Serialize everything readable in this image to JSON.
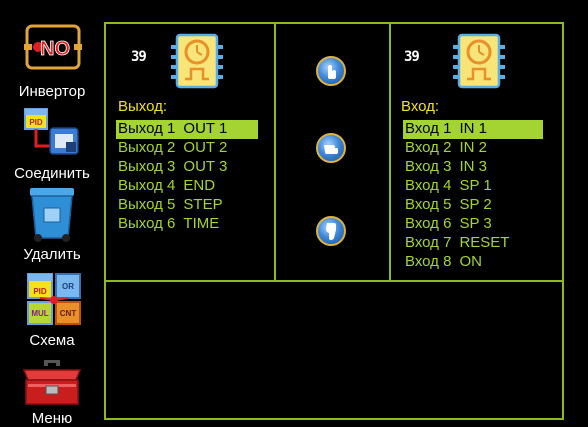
{
  "sidebar": {
    "items": [
      {
        "label": "Инвертор",
        "icon": "not-gate-icon"
      },
      {
        "label": "Соединить",
        "icon": "connect-icon"
      },
      {
        "label": "Удалить",
        "icon": "trash-bin-icon"
      },
      {
        "label": "Схема",
        "icon": "scheme-blocks-icon"
      },
      {
        "label": "Меню",
        "icon": "toolbox-icon"
      }
    ],
    "not_gate_text": "NO",
    "scheme_tiles": [
      "PID",
      "OR",
      "MUL",
      "CNT"
    ],
    "pid_badge": "PID"
  },
  "left_block": {
    "number": "39",
    "heading": "Выход:",
    "items": [
      {
        "name": "Выход 1",
        "value": "OUT 1"
      },
      {
        "name": "Выход 2",
        "value": "OUT 2"
      },
      {
        "name": "Выход 3",
        "value": "OUT 3"
      },
      {
        "name": "Выход 4",
        "value": "END"
      },
      {
        "name": "Выход 5",
        "value": "STEP"
      },
      {
        "name": "Выход 6",
        "value": "TIME"
      }
    ],
    "selected_index": 0
  },
  "right_block": {
    "number": "39",
    "heading": "Вход:",
    "items": [
      {
        "name": "Вход 1",
        "value": "IN 1"
      },
      {
        "name": "Вход 2",
        "value": "IN 2"
      },
      {
        "name": "Вход 3",
        "value": "IN 3"
      },
      {
        "name": "Вход 4",
        "value": "SP 1"
      },
      {
        "name": "Вход 5",
        "value": "SP 2"
      },
      {
        "name": "Вход 6",
        "value": "SP 3"
      },
      {
        "name": "Вход 7",
        "value": "RESET"
      },
      {
        "name": "Вход 8",
        "value": "ON"
      }
    ],
    "selected_index": 0
  },
  "middle": {
    "buttons": [
      "hand-up-icon",
      "hand-point-icon",
      "hand-down-icon"
    ]
  },
  "colors": {
    "frame": "#8dba1f",
    "list_text": "#a4d431",
    "heading": "#f1e21a",
    "selection": "#a4d431",
    "background": "#000000"
  }
}
